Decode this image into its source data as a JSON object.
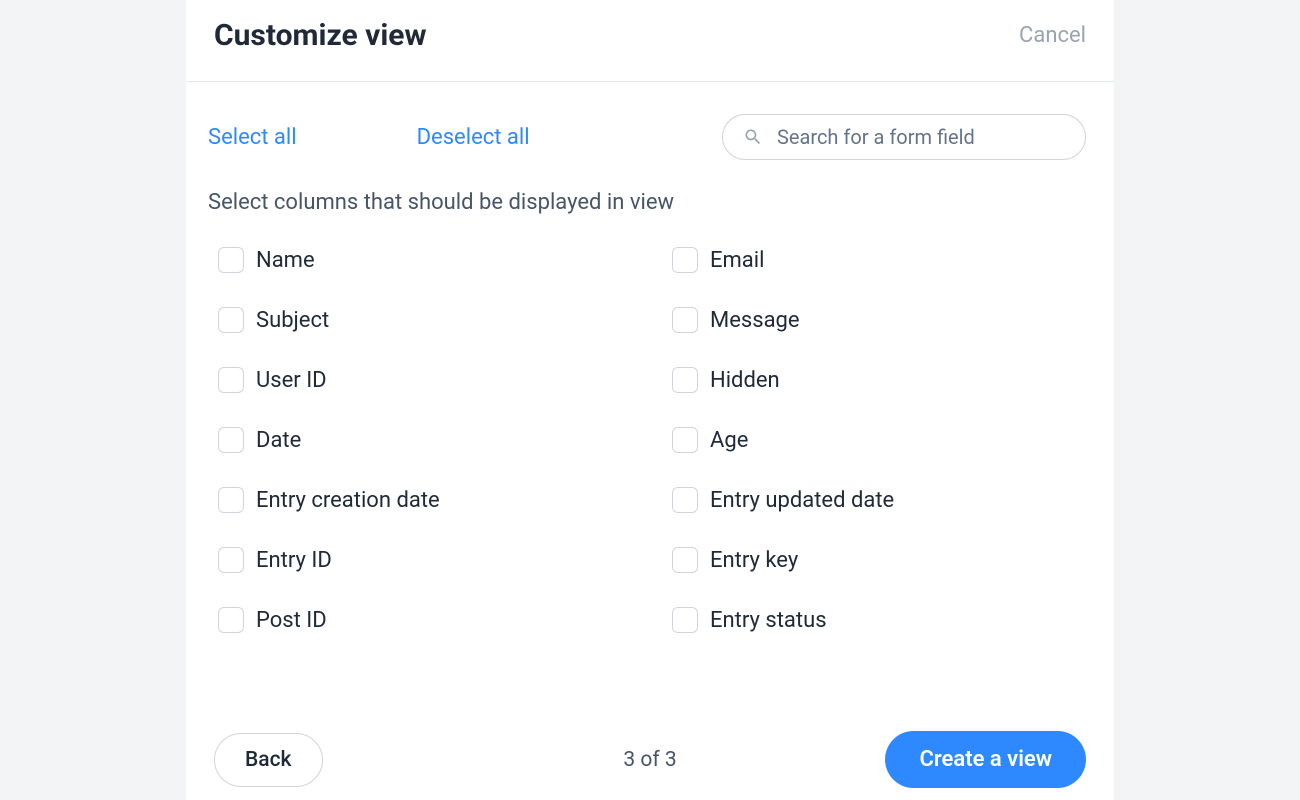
{
  "header": {
    "title": "Customize view",
    "cancel": "Cancel"
  },
  "controls": {
    "select_all": "Select all",
    "deselect_all": "Deselect all",
    "search_placeholder": "Search for a form field"
  },
  "instruction": "Select columns that should be displayed in view",
  "fields": {
    "col1": [
      "Name",
      "Subject",
      "User ID",
      "Date",
      "Entry creation date",
      "Entry ID",
      "Post ID"
    ],
    "col2": [
      "Email",
      "Message",
      "Hidden",
      "Age",
      "Entry updated date",
      "Entry key",
      "Entry status"
    ]
  },
  "footer": {
    "back": "Back",
    "step": "3 of 3",
    "create": "Create a view"
  }
}
